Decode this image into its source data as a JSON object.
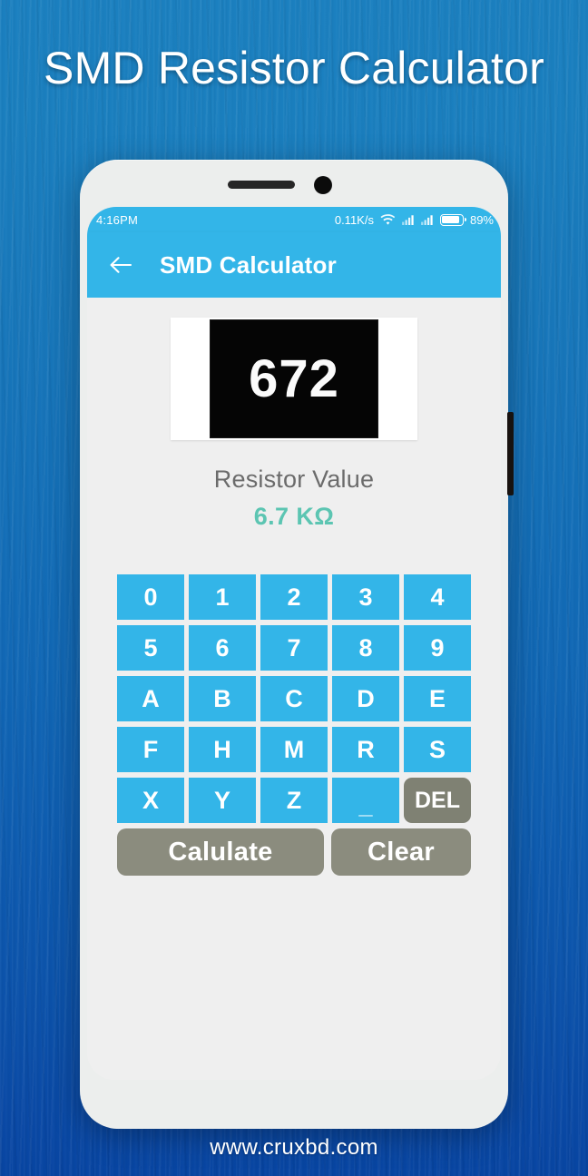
{
  "banner": {
    "title": "SMD Resistor Calculator",
    "footer_url": "www.cruxbd.com"
  },
  "phone": {
    "status_bar": {
      "time": "4:16PM",
      "network_speed": "0.11K/s",
      "wifi_icon": "wifi-icon",
      "signal_icon_1": "signal-bars-icon",
      "signal_icon_2": "signal-bars-icon",
      "battery_icon": "battery-icon",
      "battery_percent": "89%"
    },
    "app_bar": {
      "back_icon": "back-arrow-icon",
      "title": "SMD Calculator"
    },
    "resistor": {
      "code": "672"
    },
    "result": {
      "label": "Resistor Value",
      "value": "6.7 KΩ",
      "value_color": "#5cc5b2"
    },
    "keypad": {
      "rows": [
        [
          "0",
          "1",
          "2",
          "3",
          "4"
        ],
        [
          "5",
          "6",
          "7",
          "8",
          "9"
        ],
        [
          "A",
          "B",
          "C",
          "D",
          "E"
        ],
        [
          "F",
          "H",
          "M",
          "R",
          "S"
        ],
        [
          "X",
          "Y",
          "Z",
          "_",
          "DEL"
        ]
      ],
      "key_color": "#33b5e8",
      "del_color": "#7f8173"
    },
    "actions": {
      "calculate_label": "Calulate",
      "clear_label": "Clear",
      "action_color": "#8b8c7e"
    }
  }
}
